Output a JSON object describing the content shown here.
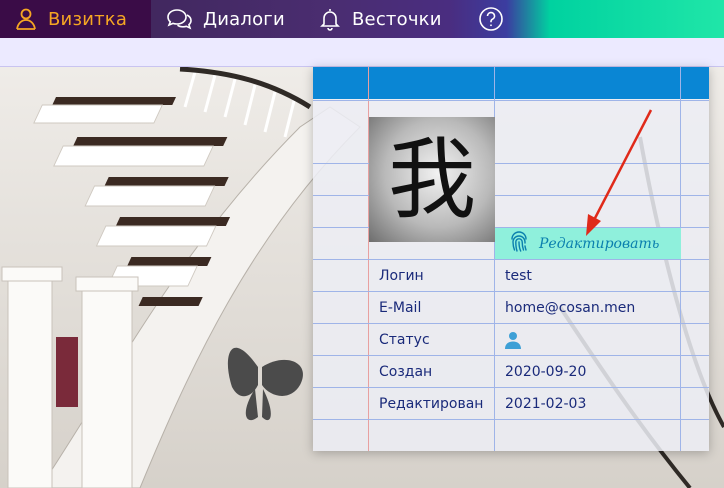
{
  "nav": {
    "items": [
      {
        "label": "Визитка",
        "icon": "user-icon",
        "active": true
      },
      {
        "label": "Диалоги",
        "icon": "chat-icon"
      },
      {
        "label": "Весточки",
        "icon": "bell-icon"
      },
      {
        "label": "",
        "icon": "help-icon"
      }
    ]
  },
  "profile": {
    "avatar_glyph": "我",
    "edit_label": "Редактировать",
    "rows": [
      {
        "label": "Логин",
        "value": "test"
      },
      {
        "label": "E-Mail",
        "value": "home@cosan.men"
      },
      {
        "label": "Статус",
        "value": "",
        "icon": "person-icon"
      },
      {
        "label": "Создан",
        "value": "2020-09-20"
      },
      {
        "label": "Редактирован",
        "value": "2021-02-03"
      }
    ]
  },
  "colors": {
    "accent": "#f5a623",
    "header_blue": "#0a86d4",
    "edit_bg": "#8ff0dc",
    "text_blue": "#1a2a7a",
    "annotation_arrow": "#e02a1a"
  }
}
